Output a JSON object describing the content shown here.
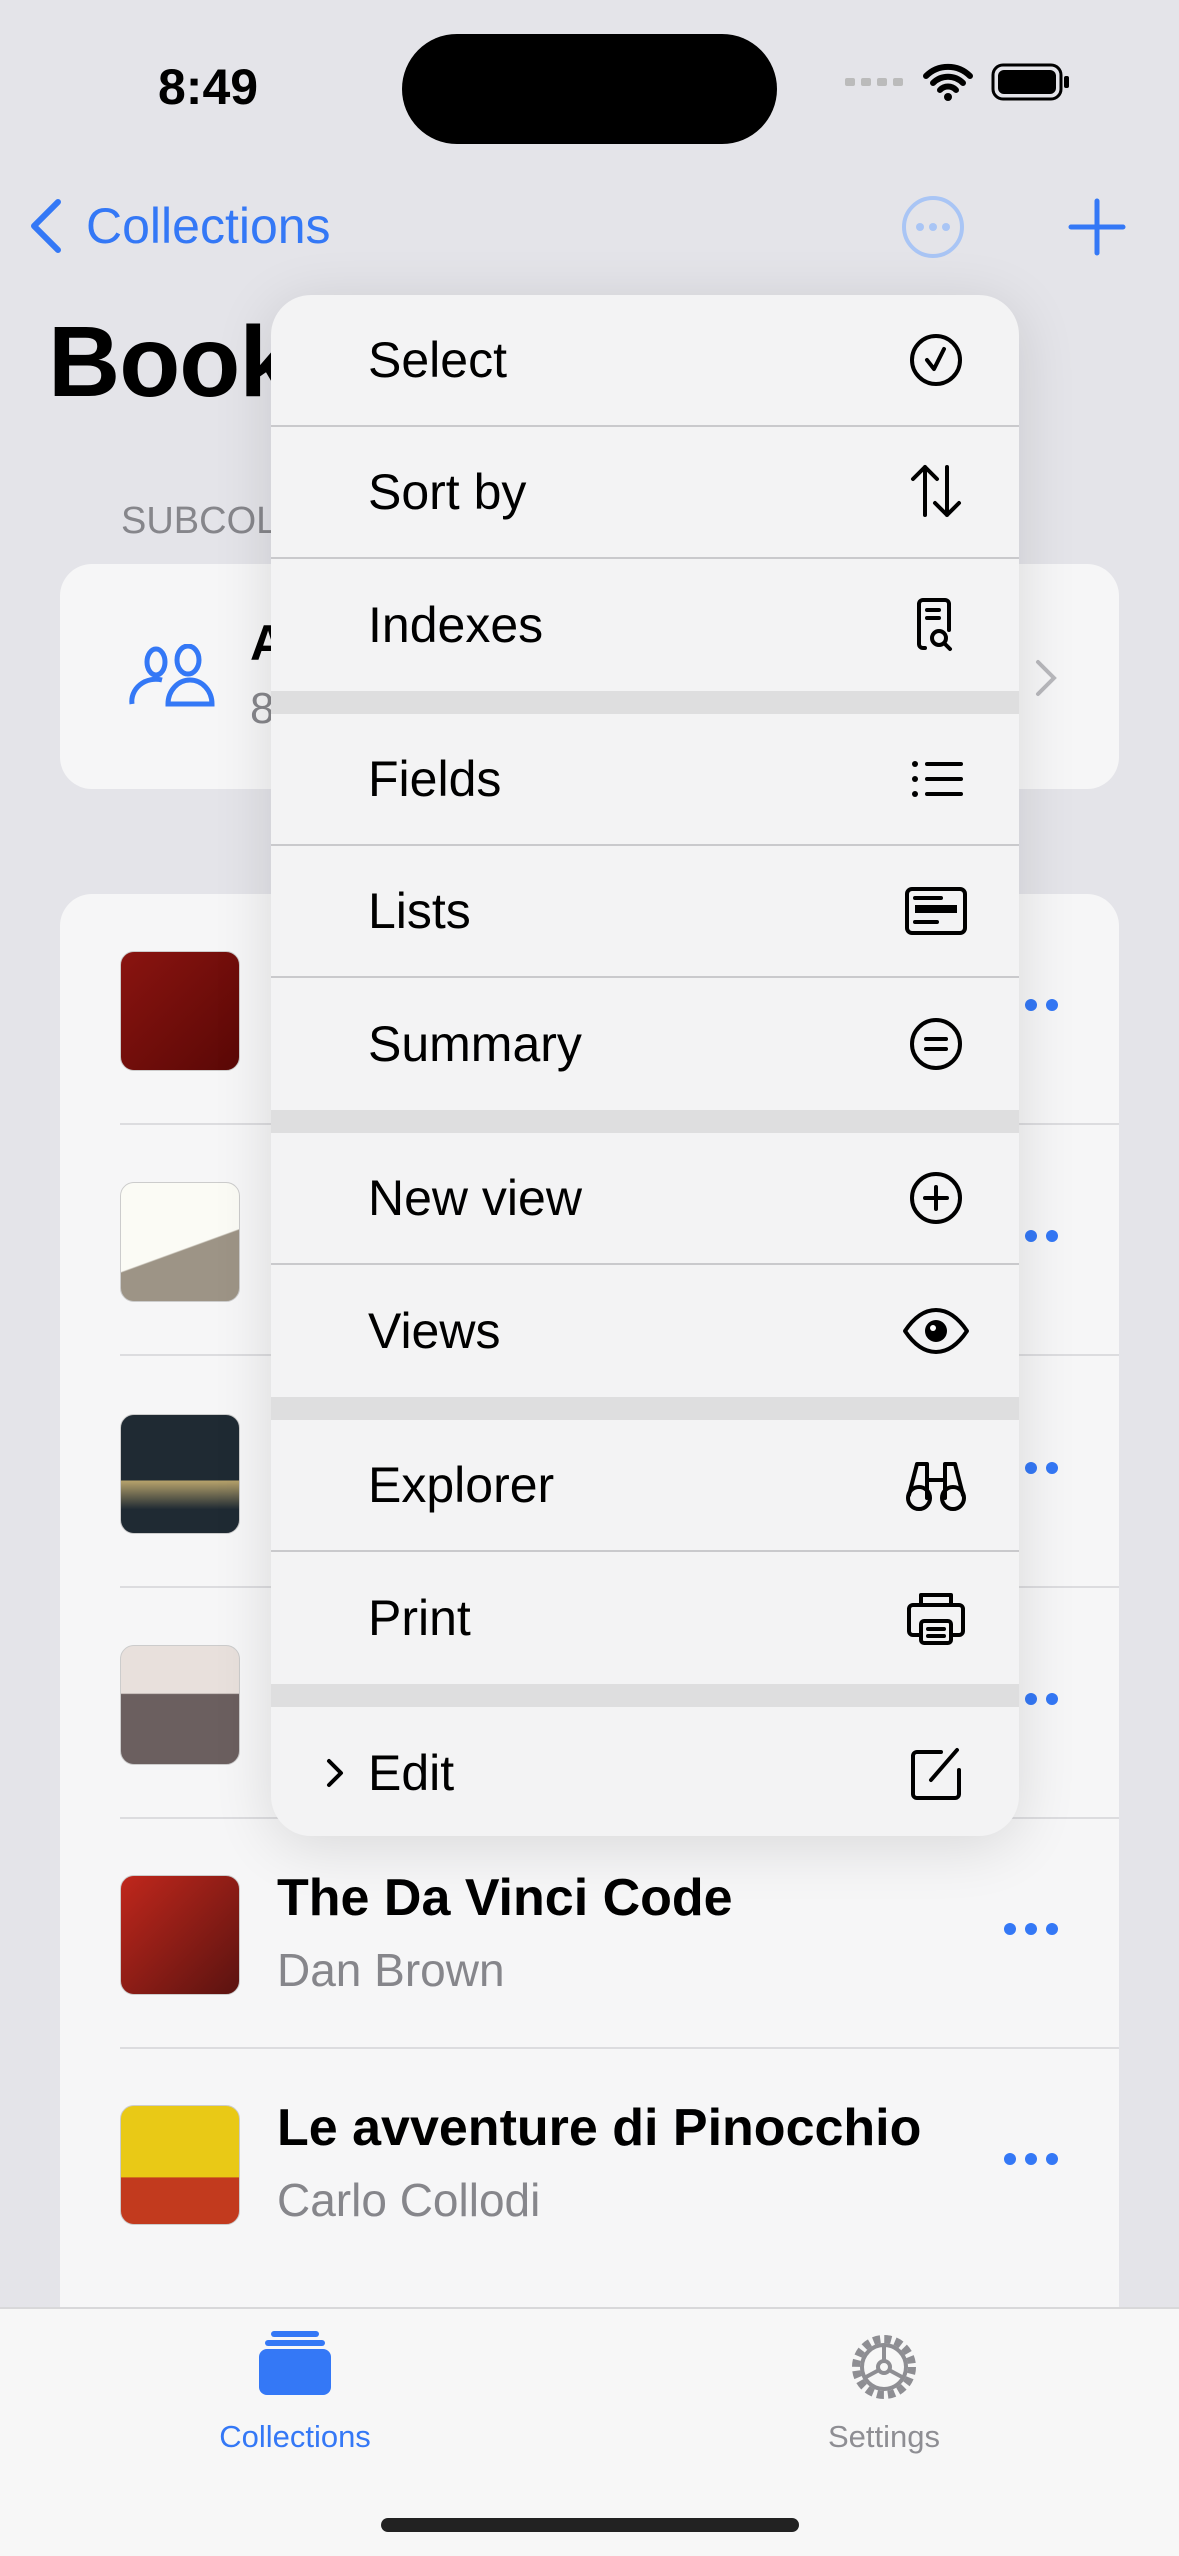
{
  "status": {
    "time": "8:49"
  },
  "nav": {
    "back_label": "Collections"
  },
  "page": {
    "title": "Book",
    "subcollections_header": "SUBCOL"
  },
  "subcollection": {
    "title": "A",
    "subtitle": "8"
  },
  "books": [
    {
      "title": "",
      "author": "",
      "cover": "potter"
    },
    {
      "title": "",
      "author": "",
      "cover": "prince"
    },
    {
      "title": "",
      "author": "",
      "cover": "hobbit"
    },
    {
      "title": "",
      "author": "",
      "cover": "christie"
    },
    {
      "title": "The Da Vinci Code",
      "author": "Dan Brown",
      "cover": "davinci"
    },
    {
      "title": "Le avventure di Pinocchio",
      "author": "Carlo Collodi",
      "cover": "pinocchio"
    }
  ],
  "menu": {
    "groups": [
      [
        {
          "label": "Select",
          "icon": "checkmark-circle-icon"
        },
        {
          "label": "Sort by",
          "icon": "arrow-up-down-icon"
        },
        {
          "label": "Indexes",
          "icon": "doc-magnifier-icon"
        }
      ],
      [
        {
          "label": "Fields",
          "icon": "list-bullet-icon"
        },
        {
          "label": "Lists",
          "icon": "list-rectangle-icon"
        },
        {
          "label": "Summary",
          "icon": "equal-circle-icon"
        }
      ],
      [
        {
          "label": "New view",
          "icon": "plus-circle-icon"
        },
        {
          "label": "Views",
          "icon": "eye-icon"
        }
      ],
      [
        {
          "label": "Explorer",
          "icon": "binoculars-icon"
        },
        {
          "label": "Print",
          "icon": "printer-icon"
        }
      ],
      [
        {
          "label": "Edit",
          "icon": "square-pencil-icon",
          "submenu": true
        }
      ]
    ]
  },
  "tabs": [
    {
      "label": "Collections",
      "active": true
    },
    {
      "label": "Settings",
      "active": false
    }
  ],
  "colors": {
    "accent": "#3478f6",
    "inactive": "#8e8e93"
  }
}
